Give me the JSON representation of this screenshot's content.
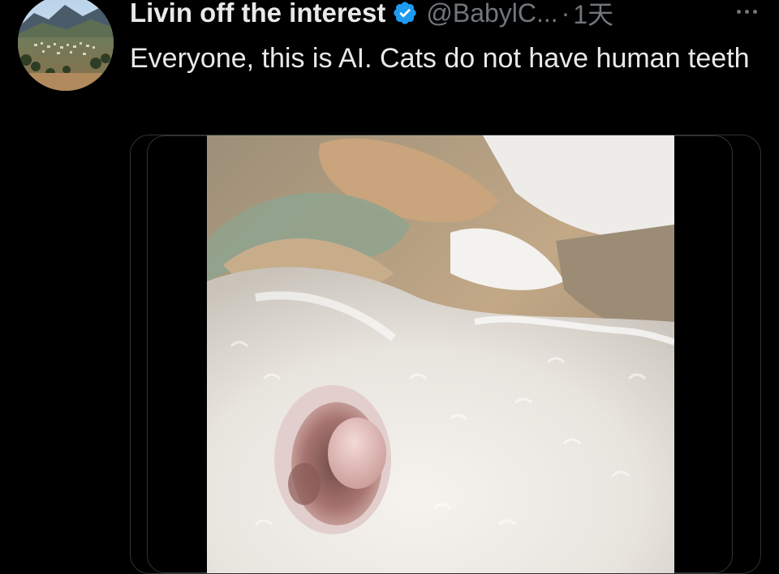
{
  "tweet": {
    "display_name": "Livin off the interest",
    "handle": "@BabylC...",
    "separator": "·",
    "time": "1天",
    "text": "Everyone, this is AI. Cats do not have human teeth",
    "avatar_icon": "mountain-landscape-avatar",
    "verified_icon": "verified-badge-icon",
    "more_icon": "more-options-icon",
    "media_icon": "cat-mouth-photo"
  },
  "colors": {
    "background": "#000000",
    "primary_text": "#e7e9ea",
    "secondary_text": "#71767b",
    "verified_blue": "#1d9bf0",
    "border": "#2f3336"
  }
}
